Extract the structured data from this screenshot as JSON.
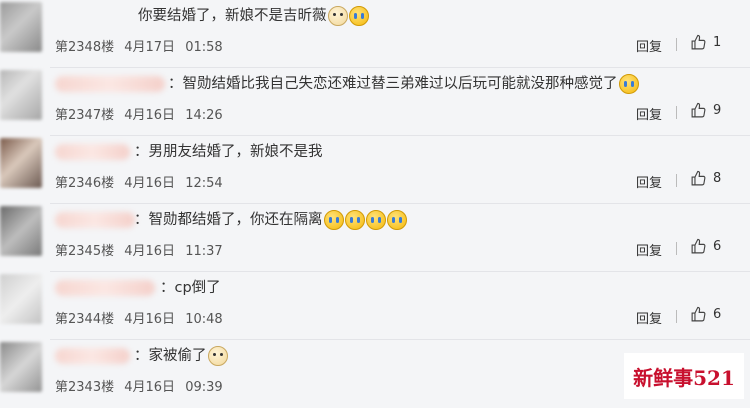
{
  "comments": [
    {
      "text": "你要结婚了，新娘不是吉昕薇",
      "floor": "第2348楼",
      "date": "4月17日",
      "time": "01:58",
      "reply": "回复",
      "likes": "1",
      "emojis": [
        "doge",
        "cry"
      ]
    },
    {
      "text": "：智勋结婚比我自己失恋还难过替三弟难过以后玩可能就没那种感觉了",
      "floor": "第2347楼",
      "date": "4月16日",
      "time": "14:26",
      "reply": "回复",
      "likes": "9",
      "emojis": [
        "cry"
      ]
    },
    {
      "text": "：男朋友结婚了，新娘不是我",
      "floor": "第2346楼",
      "date": "4月16日",
      "time": "12:54",
      "reply": "回复",
      "likes": "8",
      "emojis": []
    },
    {
      "text": "：智勋都结婚了，你还在隔离",
      "floor": "第2345楼",
      "date": "4月16日",
      "time": "11:37",
      "reply": "回复",
      "likes": "6",
      "emojis": [
        "cry",
        "cry",
        "cry",
        "cry"
      ]
    },
    {
      "text": "：cp倒了",
      "floor": "第2344楼",
      "date": "4月16日",
      "time": "10:48",
      "reply": "回复",
      "likes": "6",
      "emojis": []
    },
    {
      "text": "：家被偷了",
      "floor": "第2343楼",
      "date": "4月16日",
      "time": "09:39",
      "reply": "回复",
      "likes": "",
      "emojis": [
        "doge"
      ]
    }
  ],
  "watermark": "新鲜事521",
  "colors": {
    "background": "#f4f5f7",
    "watermark": "#c8102e",
    "text": "#333333"
  }
}
